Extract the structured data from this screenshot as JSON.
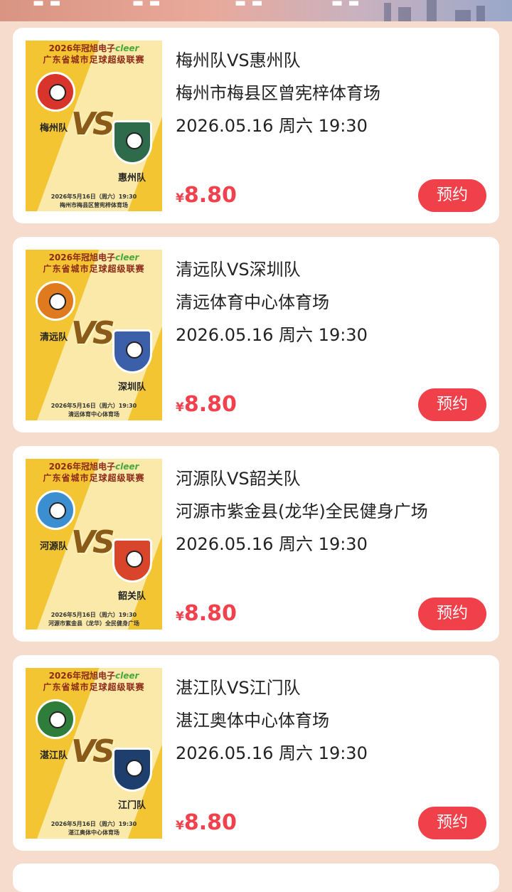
{
  "colors": {
    "page_bg": "#f6dccd",
    "price": "#f1414c",
    "button": "#f0404a",
    "poster_yellow": "#f3c533"
  },
  "poster_common": {
    "line1_prefix": "2026年冠旭电子",
    "line1_brand": "cleer",
    "line2": "广东省城市足球超级联赛",
    "vs": "VS"
  },
  "matches": [
    {
      "title": "梅州队VS惠州队",
      "venue": "梅州市梅县区曾宪梓体育场",
      "datetime": "2026.05.16 周六 19:30",
      "price_symbol": "¥",
      "price": "8.80",
      "button": "预约",
      "poster": {
        "home": "梅州队",
        "away": "惠州队",
        "date": "2026年5月16日（周六）19:30",
        "venue": "梅州市梅县区曾宪梓体育场",
        "home_color": "#d9342b",
        "away_color": "#2e6b4a"
      }
    },
    {
      "title": "清远队VS深圳队",
      "venue": "清远体育中心体育场",
      "datetime": "2026.05.16 周六 19:30",
      "price_symbol": "¥",
      "price": "8.80",
      "button": "预约",
      "poster": {
        "home": "清远队",
        "away": "深圳队",
        "date": "2026年5月16日（周六）19:30",
        "venue": "清远体育中心体育场",
        "home_color": "#e07a1f",
        "away_color": "#3b5fa8"
      }
    },
    {
      "title": "河源队VS韶关队",
      "venue": "河源市紫金县(龙华)全民健身广场",
      "datetime": "2026.05.16 周六 19:30",
      "price_symbol": "¥",
      "price": "8.80",
      "button": "预约",
      "poster": {
        "home": "河源队",
        "away": "韶关队",
        "date": "2026年5月16日（周六）19:30",
        "venue": "河源市紫金县（龙华）全民健身广场",
        "home_color": "#3b8fd1",
        "away_color": "#d9452b"
      }
    },
    {
      "title": "湛江队VS江门队",
      "venue": "湛江奥体中心体育场",
      "datetime": "2026.05.16 周六 19:30",
      "price_symbol": "¥",
      "price": "8.80",
      "button": "预约",
      "poster": {
        "home": "湛江队",
        "away": "江门队",
        "date": "2026年5月16日（周六）19:30",
        "venue": "湛江奥体中心体育场",
        "home_color": "#2f7d3a",
        "away_color": "#1e3e6e"
      }
    }
  ]
}
